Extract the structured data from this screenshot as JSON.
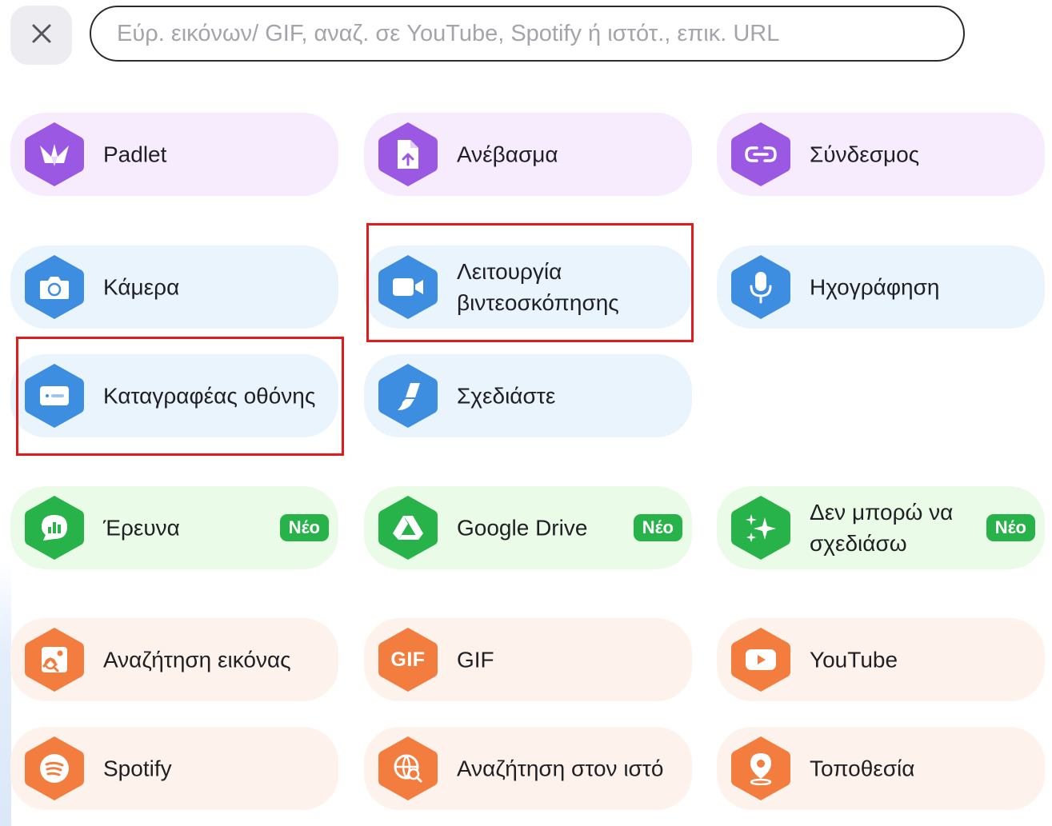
{
  "search": {
    "value": "",
    "placeholder": "Εύρ. εικόνων/ GIF, αναζ. σε YouTube, Spotify ή ιστότ., επικ. URL"
  },
  "colors": {
    "purple_icon": "#9b59e3",
    "purple_bg": "#f6ecfd",
    "blue_icon": "#3d8ee0",
    "blue_bg": "#eaf4fd",
    "green_icon": "#27b349",
    "green_bg": "#eafbe8",
    "orange_icon": "#f27d3e",
    "orange_bg": "#fdf3ec",
    "highlight": "#e21a1a"
  },
  "tiles": {
    "padlet": {
      "label": "Padlet",
      "icon": "padlet-bird-icon"
    },
    "upload": {
      "label": "Ανέβασμα",
      "icon": "upload-file-icon"
    },
    "link": {
      "label": "Σύνδεσμος",
      "icon": "link-icon"
    },
    "camera": {
      "label": "Κάμερα",
      "icon": "camera-icon"
    },
    "video": {
      "label": "Λειτουργία βιντεοσκόπησης",
      "icon": "video-camera-icon"
    },
    "audio": {
      "label": "Ηχογράφηση",
      "icon": "microphone-icon"
    },
    "screen": {
      "label": "Καταγραφέας οθόνης",
      "icon": "screen-recorder-icon"
    },
    "draw": {
      "label": "Σχεδιάστε",
      "icon": "brush-icon"
    },
    "poll": {
      "label": "Έρευνα",
      "icon": "poll-chat-icon",
      "badge": "Νέο"
    },
    "drive": {
      "label": "Google Drive",
      "icon": "google-drive-icon",
      "badge": "Νέο"
    },
    "ai": {
      "label": "Δεν μπορώ να σχεδιάσω",
      "icon": "sparkles-icon",
      "badge": "Νέο"
    },
    "image_search": {
      "label": "Αναζήτηση εικόνας",
      "icon": "image-search-icon"
    },
    "gif": {
      "label": "GIF",
      "icon": "gif-icon",
      "icon_text": "GIF"
    },
    "youtube": {
      "label": "YouTube",
      "icon": "youtube-play-icon"
    },
    "spotify": {
      "label": "Spotify",
      "icon": "spotify-icon"
    },
    "web_search": {
      "label": "Αναζήτηση στον ιστό",
      "icon": "globe-search-icon"
    },
    "location": {
      "label": "Τοποθεσία",
      "icon": "map-pin-icon"
    }
  }
}
